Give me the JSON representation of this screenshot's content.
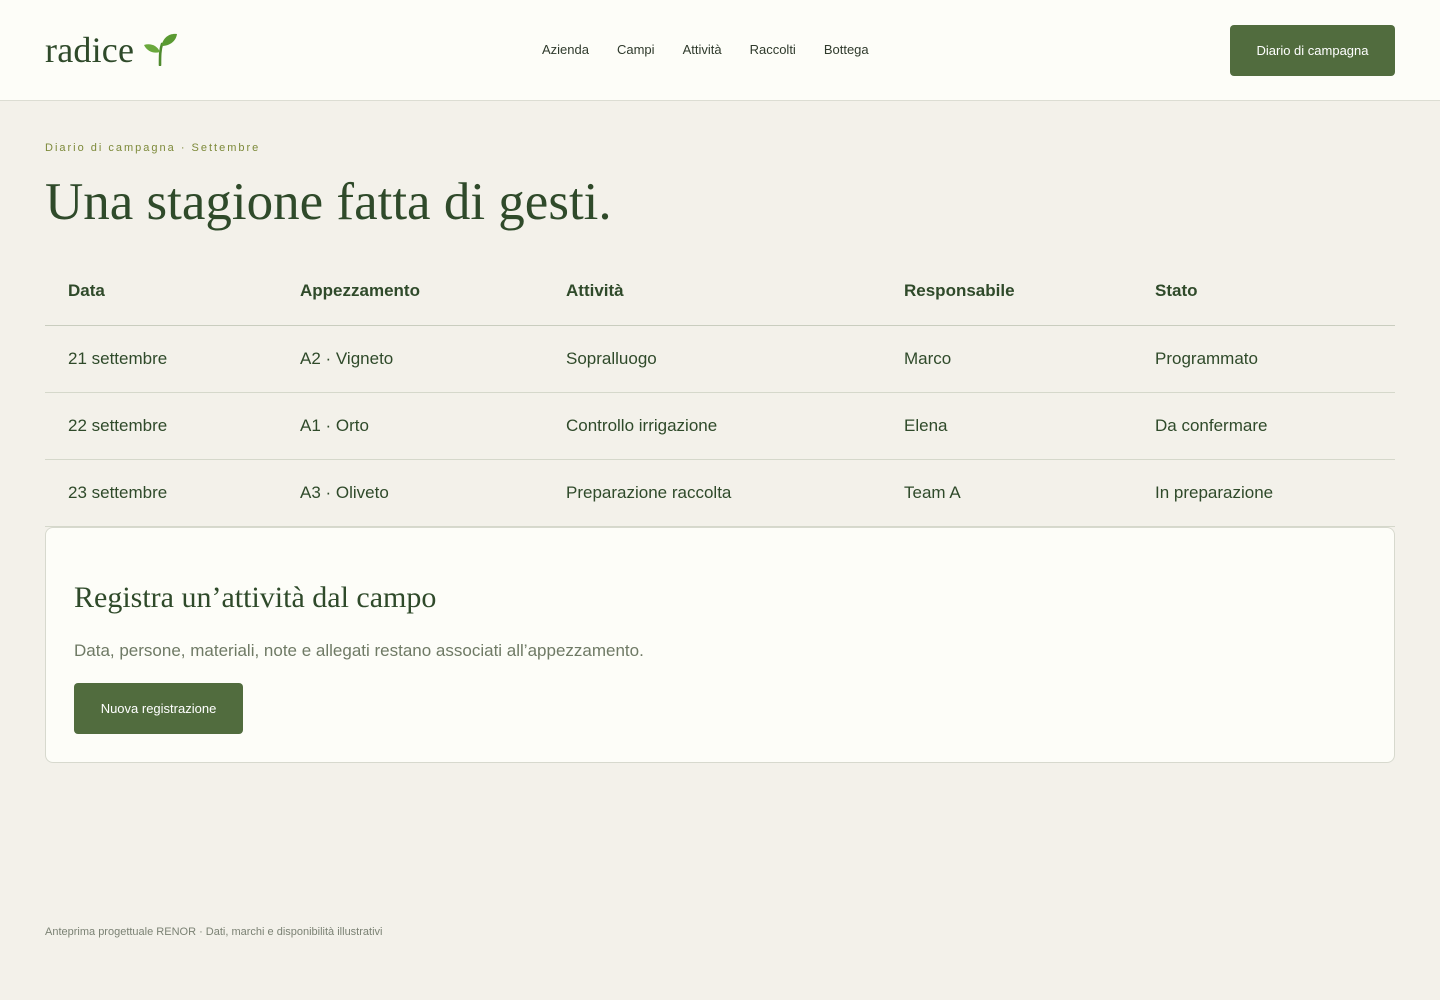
{
  "brand": {
    "name": "radice",
    "icon": "sprout-icon",
    "color": "#2f4a2a"
  },
  "nav": {
    "items": [
      "Azienda",
      "Campi",
      "Attività",
      "Raccolti",
      "Bottega"
    ]
  },
  "header": {
    "cta_label": "Diario di campagna",
    "accent": "#516c3e"
  },
  "hero": {
    "eyebrow": "Diario di campagna · Settembre",
    "title": "Una stagione fatta di gesti."
  },
  "table": {
    "columns": [
      "Data",
      "Appezzamento",
      "Attività",
      "Responsabile",
      "Stato"
    ],
    "rows": [
      [
        "21 settembre",
        "A2 · Vigneto",
        "Sopralluogo",
        "Marco",
        "Programmato"
      ],
      [
        "22 settembre",
        "A1 · Orto",
        "Controllo irrigazione",
        "Elena",
        "Da confermare"
      ],
      [
        "23 settembre",
        "A3 · Oliveto",
        "Preparazione raccolta",
        "Team A",
        "In preparazione"
      ]
    ]
  },
  "panel": {
    "title": "Registra un’attività dal campo",
    "description": "Data, persone, materiali, note e allegati restano associati all’appezzamento.",
    "button_label": "Nuova registrazione"
  },
  "footer": {
    "text": "Anteprima progettuale RENOR · Dati, marchi e disponibilità illustrativi"
  }
}
